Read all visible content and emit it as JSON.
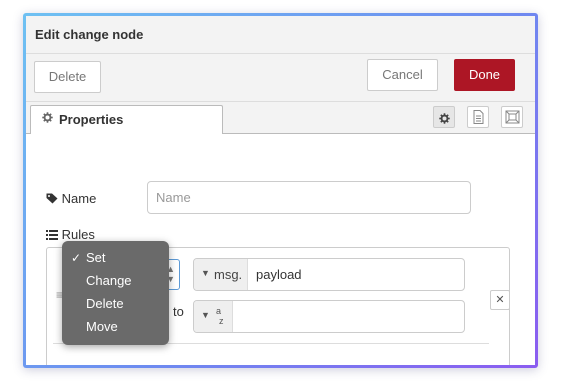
{
  "dialog": {
    "title": "Edit change node"
  },
  "toolbar": {
    "delete_label": "Delete",
    "cancel_label": "Cancel",
    "done_label": "Done",
    "done_color": "#ad1625"
  },
  "tabs": {
    "active_label": "Properties",
    "icons": [
      "gear-icon",
      "description-icon",
      "appearance-icon"
    ]
  },
  "form": {
    "name_label": "Name",
    "name_placeholder": "Name",
    "rules_label": "Rules"
  },
  "rule": {
    "to_label": "to",
    "property_type": "msg.",
    "property_value": "payload",
    "value_type_top": "a",
    "value_type_bottom": "z"
  },
  "action_menu": {
    "items": [
      {
        "label": "Set",
        "checked": true
      },
      {
        "label": "Change",
        "checked": false
      },
      {
        "label": "Delete",
        "checked": false
      },
      {
        "label": "Move",
        "checked": false
      }
    ],
    "checkmark": "✓"
  }
}
